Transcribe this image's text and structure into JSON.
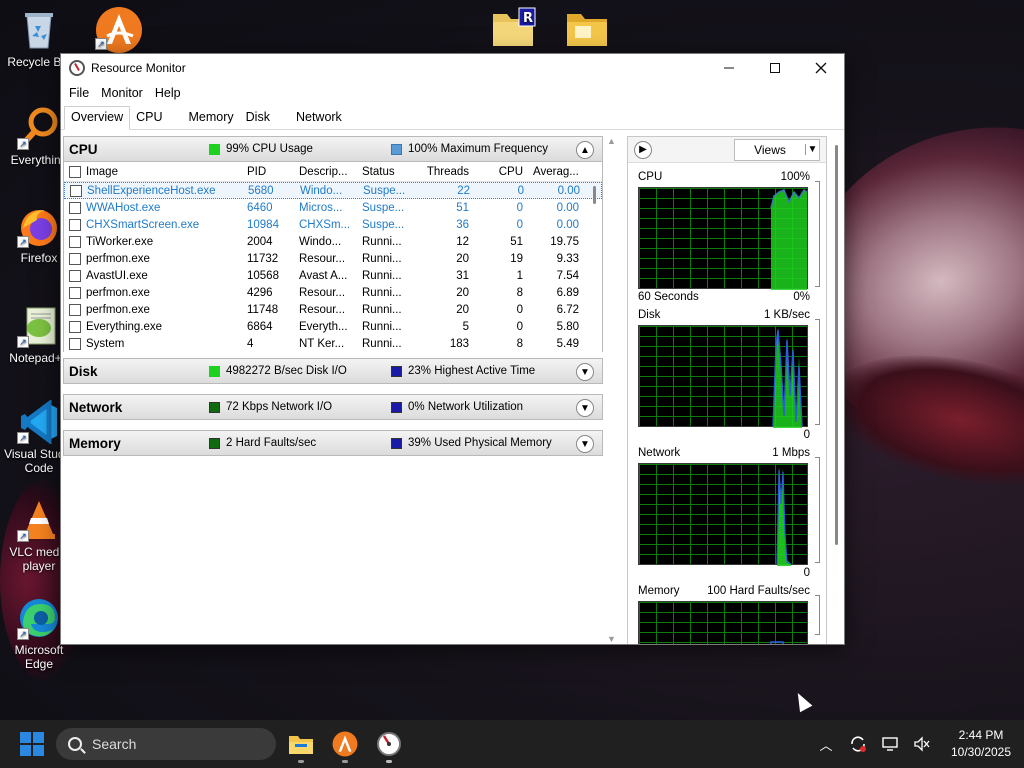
{
  "desktop": {
    "icons": [
      {
        "label": "Recycle Bin",
        "icon": "recycle-bin-icon"
      },
      {
        "label": "",
        "icon": "app-a-icon"
      },
      {
        "label": "Everything",
        "icon": "everything-search-icon"
      },
      {
        "label": "Firefox",
        "icon": "firefox-icon"
      },
      {
        "label": "Notepad++",
        "icon": "notepadpp-icon"
      },
      {
        "label": "Visual Studio Code",
        "icon": "vscode-icon"
      },
      {
        "label": "VLC media player",
        "icon": "vlc-icon"
      },
      {
        "label": "Microsoft Edge",
        "icon": "edge-icon"
      }
    ]
  },
  "window": {
    "title": "Resource Monitor",
    "menu": [
      "File",
      "Monitor",
      "Help"
    ],
    "tabs": [
      "Overview",
      "CPU",
      "Memory",
      "Disk",
      "Network"
    ],
    "active_tab": "Overview"
  },
  "colors": {
    "green": "#1fd11f",
    "blue": "#1a1aa6",
    "lightblue": "#5b9bd5",
    "darkgreen": "#0f6b0f"
  },
  "cpu": {
    "name": "CPU",
    "stat1": "99% CPU Usage",
    "stat2": "100% Maximum Frequency",
    "columns": [
      "Image",
      "PID",
      "Descrip...",
      "Status",
      "Threads",
      "CPU",
      "Averag..."
    ],
    "rows": [
      {
        "image": "ShellExperienceHost.exe",
        "pid": "5680",
        "desc": "Windo...",
        "status": "Suspe...",
        "threads": "22",
        "cpu": "0",
        "avg": "0.00",
        "suspended": true,
        "selected": true
      },
      {
        "image": "WWAHost.exe",
        "pid": "6460",
        "desc": "Micros...",
        "status": "Suspe...",
        "threads": "51",
        "cpu": "0",
        "avg": "0.00",
        "suspended": true
      },
      {
        "image": "CHXSmartScreen.exe",
        "pid": "10984",
        "desc": "CHXSm...",
        "status": "Suspe...",
        "threads": "36",
        "cpu": "0",
        "avg": "0.00",
        "suspended": true
      },
      {
        "image": "TiWorker.exe",
        "pid": "2004",
        "desc": "Windo...",
        "status": "Runni...",
        "threads": "12",
        "cpu": "51",
        "avg": "19.75"
      },
      {
        "image": "perfmon.exe",
        "pid": "11732",
        "desc": "Resour...",
        "status": "Runni...",
        "threads": "20",
        "cpu": "19",
        "avg": "9.33"
      },
      {
        "image": "AvastUI.exe",
        "pid": "10568",
        "desc": "Avast A...",
        "status": "Runni...",
        "threads": "31",
        "cpu": "1",
        "avg": "7.54"
      },
      {
        "image": "perfmon.exe",
        "pid": "4296",
        "desc": "Resour...",
        "status": "Runni...",
        "threads": "20",
        "cpu": "8",
        "avg": "6.89"
      },
      {
        "image": "perfmon.exe",
        "pid": "11748",
        "desc": "Resour...",
        "status": "Runni...",
        "threads": "20",
        "cpu": "0",
        "avg": "6.72"
      },
      {
        "image": "Everything.exe",
        "pid": "6864",
        "desc": "Everyth...",
        "status": "Runni...",
        "threads": "5",
        "cpu": "0",
        "avg": "5.80"
      },
      {
        "image": "System",
        "pid": "4",
        "desc": "NT Ker...",
        "status": "Runni...",
        "threads": "183",
        "cpu": "8",
        "avg": "5.49"
      }
    ]
  },
  "disk": {
    "name": "Disk",
    "stat1": "4982272 B/sec Disk I/O",
    "stat2": "23% Highest Active Time"
  },
  "network": {
    "name": "Network",
    "stat1": "72 Kbps Network I/O",
    "stat2": "0% Network Utilization"
  },
  "memory": {
    "name": "Memory",
    "stat1": "2 Hard Faults/sec",
    "stat2": "39% Used Physical Memory"
  },
  "graphs": {
    "views_label": "Views",
    "cpu": {
      "name": "CPU",
      "max": "100%",
      "left": "60 Seconds",
      "right": "0%"
    },
    "disk": {
      "name": "Disk",
      "max": "1 KB/sec",
      "right": "0"
    },
    "network": {
      "name": "Network",
      "max": "1 Mbps",
      "right": "0"
    },
    "memory": {
      "name": "Memory",
      "max": "100 Hard Faults/sec"
    }
  },
  "taskbar": {
    "search_placeholder": "Search",
    "time": "2:44 PM",
    "date": "10/30/2025"
  }
}
